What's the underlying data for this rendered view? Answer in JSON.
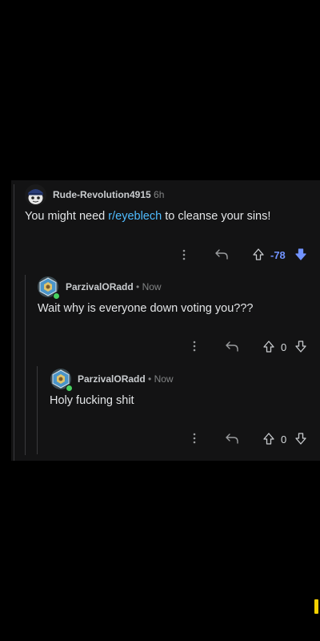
{
  "comments": [
    {
      "username": "Rude-Revolution4915",
      "time": "6h",
      "body_pre": "You might need ",
      "body_link": "r/eyeblech",
      "body_post": " to cleanse your sins!",
      "vote_count": "-78",
      "vote_state": "downvoted"
    },
    {
      "username": "ParzivalORadd",
      "separator": "•",
      "time": "Now",
      "body": "Wait why is everyone down voting you???",
      "vote_count": "0"
    },
    {
      "username": "ParzivalORadd",
      "separator": "•",
      "time": "Now",
      "body": "Holy fucking shit",
      "vote_count": "0"
    }
  ],
  "icons": {
    "more": "more-vertical-icon",
    "reply": "reply-arrow-icon",
    "upvote": "upvote-arrow-icon",
    "downvote": "downvote-arrow-icon"
  },
  "colors": {
    "background": "#000000",
    "panel": "#131314",
    "link": "#4fbcff",
    "downvote_active": "#7193ff",
    "online": "#46d160"
  }
}
